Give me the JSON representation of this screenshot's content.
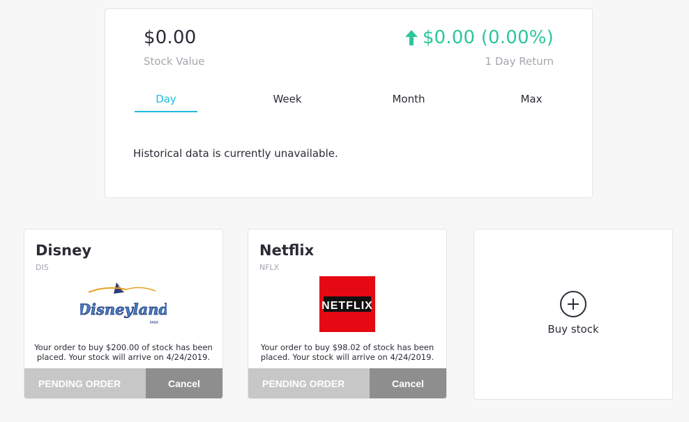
{
  "summary": {
    "stock_value": "$0.00",
    "stock_value_label": "Stock Value",
    "day_return": "$0.00 (0.00%)",
    "day_return_label": "1 Day Return",
    "return_color": "#2ec59c",
    "tabs": [
      {
        "label": "Day",
        "active": true
      },
      {
        "label": "Week",
        "active": false
      },
      {
        "label": "Month",
        "active": false
      },
      {
        "label": "Max",
        "active": false
      }
    ],
    "historical_message": "Historical data is currently unavailable."
  },
  "stocks": [
    {
      "name": "Disney",
      "ticker": "DIS",
      "logo_icon": "disneyland-logo",
      "logo_text": "Disneyland",
      "logo_small_text": "PARK",
      "order_message": "Your order to buy $200.00 of stock has been placed. Your stock will arrive on 4/24/2019.",
      "pending_label": "PENDING ORDER",
      "cancel_label": "Cancel"
    },
    {
      "name": "Netflix",
      "ticker": "NFLX",
      "logo_icon": "netflix-logo",
      "logo_text": "NETFLIX",
      "order_message": "Your order to buy $98.02 of stock has been placed. Your stock will arrive on 4/24/2019.",
      "pending_label": "PENDING ORDER",
      "cancel_label": "Cancel"
    }
  ],
  "buy": {
    "label": "Buy stock",
    "icon": "plus-circle-icon"
  }
}
